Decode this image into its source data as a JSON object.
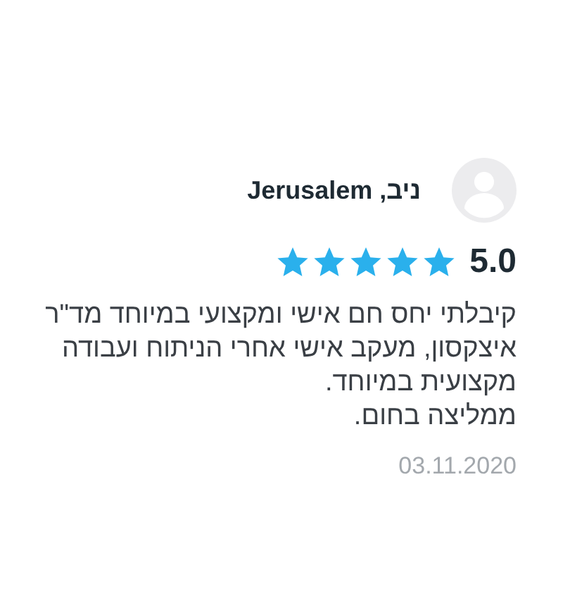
{
  "review": {
    "author": "ניב, Jerusalem",
    "rating": "5.0",
    "stars": 5,
    "paragraphs": [
      "קיבלתי יחס חם אישי ומקצועי במיוחד מד\"ר איצקסון, מעקב אישי אחרי הניתוח ועבודה מקצועית במיוחד.",
      "ממליצה בחום."
    ],
    "date": "03.11.2020"
  }
}
